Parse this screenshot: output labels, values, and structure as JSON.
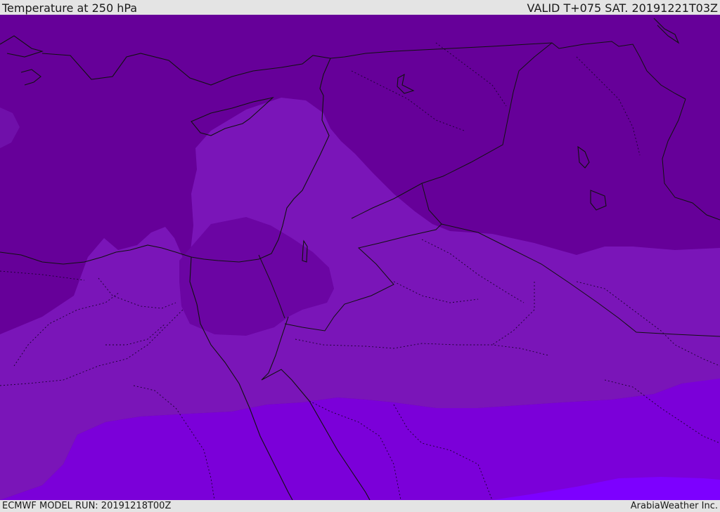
{
  "header": {
    "title": "Temperature at 250 hPa",
    "valid_time": "VALID T+075 SAT. 20191221T03Z"
  },
  "footer": {
    "model_run": "ECMWF MODEL RUN: 20191218T00Z",
    "credit": "ArabiaWeather Inc."
  },
  "map": {
    "field": "temperature-250hPa",
    "colors": {
      "coldest": "#660099",
      "cold": "#7010aa",
      "mid": "#7a15b8",
      "warm": "#7b00d9",
      "warmest": "#7d00ff",
      "border": "#111111"
    }
  }
}
